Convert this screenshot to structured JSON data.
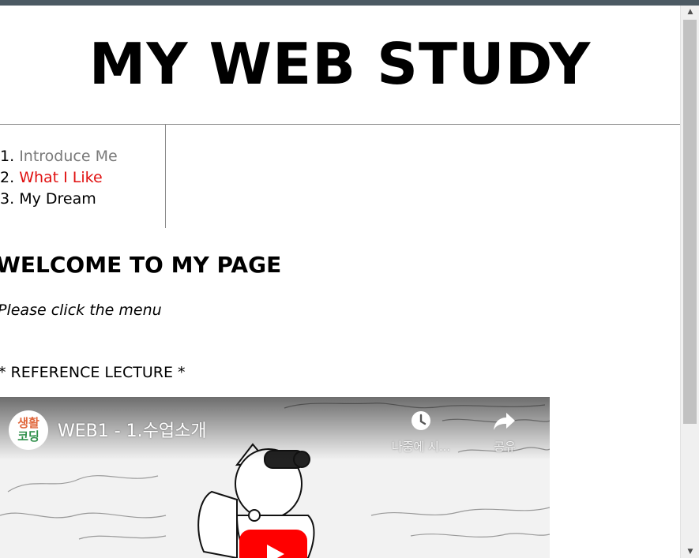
{
  "page": {
    "title": "MY WEB STUDY",
    "heading": "WELCOME TO MY PAGE",
    "hint": "Please click the menu",
    "reference_label": "* REFERENCE LECTURE *"
  },
  "nav": {
    "items": [
      {
        "number": "1.",
        "label": "Introduce Me",
        "state": "visited"
      },
      {
        "number": "2.",
        "label": "What I Like",
        "state": "active"
      },
      {
        "number": "3.",
        "label": "My Dream",
        "state": "normal"
      }
    ]
  },
  "video": {
    "channel_avatar_line1": "생활",
    "channel_avatar_line2": "코딩",
    "title": "WEB1 - 1.수업소개",
    "watch_later_label": "나중에 시...",
    "share_label": "공유",
    "icons": {
      "watch_later": "clock-icon",
      "share": "share-arrow-icon",
      "play": "play-icon"
    }
  },
  "colors": {
    "visited_link": "#7a7a7a",
    "active_link": "#e01010",
    "youtube_red": "#ff0000"
  }
}
